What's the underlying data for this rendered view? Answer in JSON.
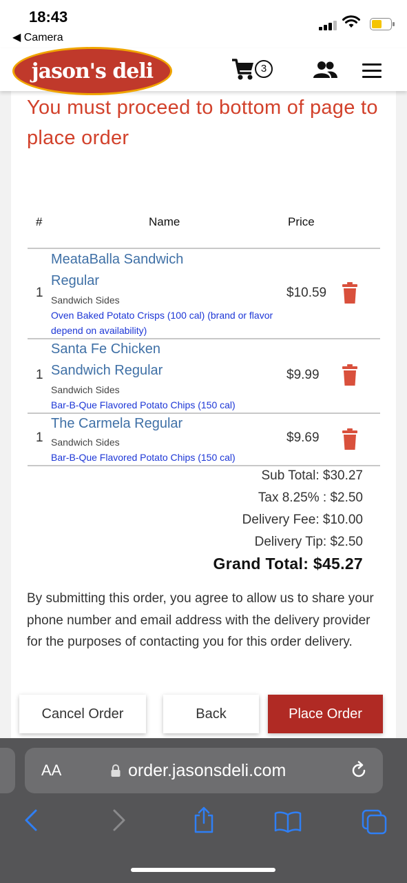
{
  "status_bar": {
    "time": "18:43",
    "back_app": "Camera"
  },
  "header": {
    "logo_text": "jason's deli",
    "cart_count": "3"
  },
  "warning": "You must proceed to bottom of page to place order",
  "table": {
    "col_num": "#",
    "col_name": "Name",
    "col_price": "Price",
    "items": [
      {
        "qty": "1",
        "name_line1": "MeataBalla Sandwich",
        "name_line2": "Regular",
        "sides_label": "Sandwich Sides",
        "sides": "Oven Baked Potato Crisps (100 cal) (brand or flavor depend on availability)",
        "price": "$10.59"
      },
      {
        "qty": "1",
        "name_line1": "Santa Fe Chicken",
        "name_line2": "Sandwich Regular",
        "sides_label": "Sandwich Sides",
        "sides": "Bar-B-Que Flavored Potato Chips (150 cal)",
        "price": "$9.99"
      },
      {
        "qty": "1",
        "name_line1": "The Carmela Regular",
        "name_line2": "",
        "sides_label": "Sandwich Sides",
        "sides": "Bar-B-Que Flavored Potato Chips (150 cal)",
        "price": "$9.69"
      }
    ]
  },
  "totals": {
    "sub_total": "Sub Total: $30.27",
    "tax": "Tax 8.25% : $2.50",
    "delivery_fee": "Delivery Fee: $10.00",
    "delivery_tip": "Delivery Tip: $2.50",
    "grand_total": "Grand Total: $45.27"
  },
  "disclaimer": "By submitting this order, you agree to allow us to share your phone number and email address with the delivery provider for the purposes of contacting you for this order delivery.",
  "buttons": {
    "cancel": "Cancel Order",
    "back": "Back",
    "place": "Place Order"
  },
  "browser": {
    "aa": "AA",
    "url": "order.jasonsdeli.com"
  },
  "colors": {
    "brand_red": "#b02a24",
    "warning_red": "#d2412b",
    "item_blue": "#3f70a6",
    "sides_blue": "#1c36d6",
    "safari_blue": "#2f7ff5"
  }
}
